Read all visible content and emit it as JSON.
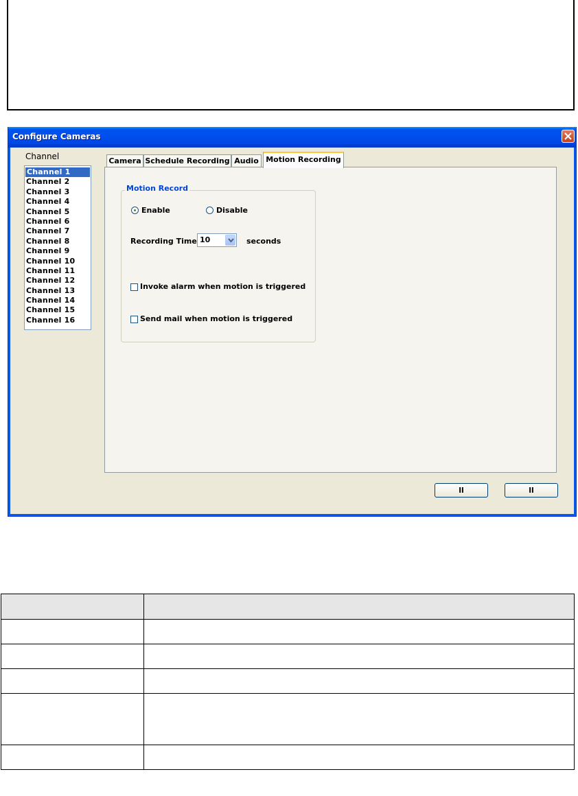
{
  "dialog": {
    "title": "Configure Cameras",
    "channel_label": "Channel",
    "channels": [
      "Channel 1",
      "Channel 2",
      "Channel 3",
      "Channel 4",
      "Channel 5",
      "Channel 6",
      "Channel 7",
      "Channel 8",
      "Channel 9",
      "Channel 10",
      "Channel 11",
      "Channel 12",
      "Channel 13",
      "Channel 14",
      "Channel 15",
      "Channel 16"
    ],
    "selected_channel": "Channel 1",
    "tabs": [
      "Camera",
      "Schedule Recording",
      "Audio",
      "Motion Recording"
    ],
    "active_tab": "Motion Recording",
    "motion_record": {
      "group_title": "Motion Record",
      "enable_label": "Enable",
      "disable_label": "Disable",
      "selected": "Enable",
      "recording_time_label": "Recording Time",
      "recording_time_value": "10",
      "seconds_label": "seconds",
      "invoke_alarm_label": "Invoke alarm when motion is triggered",
      "invoke_alarm_checked": false,
      "send_mail_label": "Send mail when motion is triggered",
      "send_mail_checked": false
    },
    "buttons": {
      "ok_label": "ll",
      "cancel_label": "ll"
    }
  },
  "colors": {
    "titlebar": "#0053ee",
    "dialog_bg": "#ece9d8",
    "selection": "#316ac5",
    "group_title": "#0046d5",
    "tab_highlight": "#ffc83c"
  }
}
